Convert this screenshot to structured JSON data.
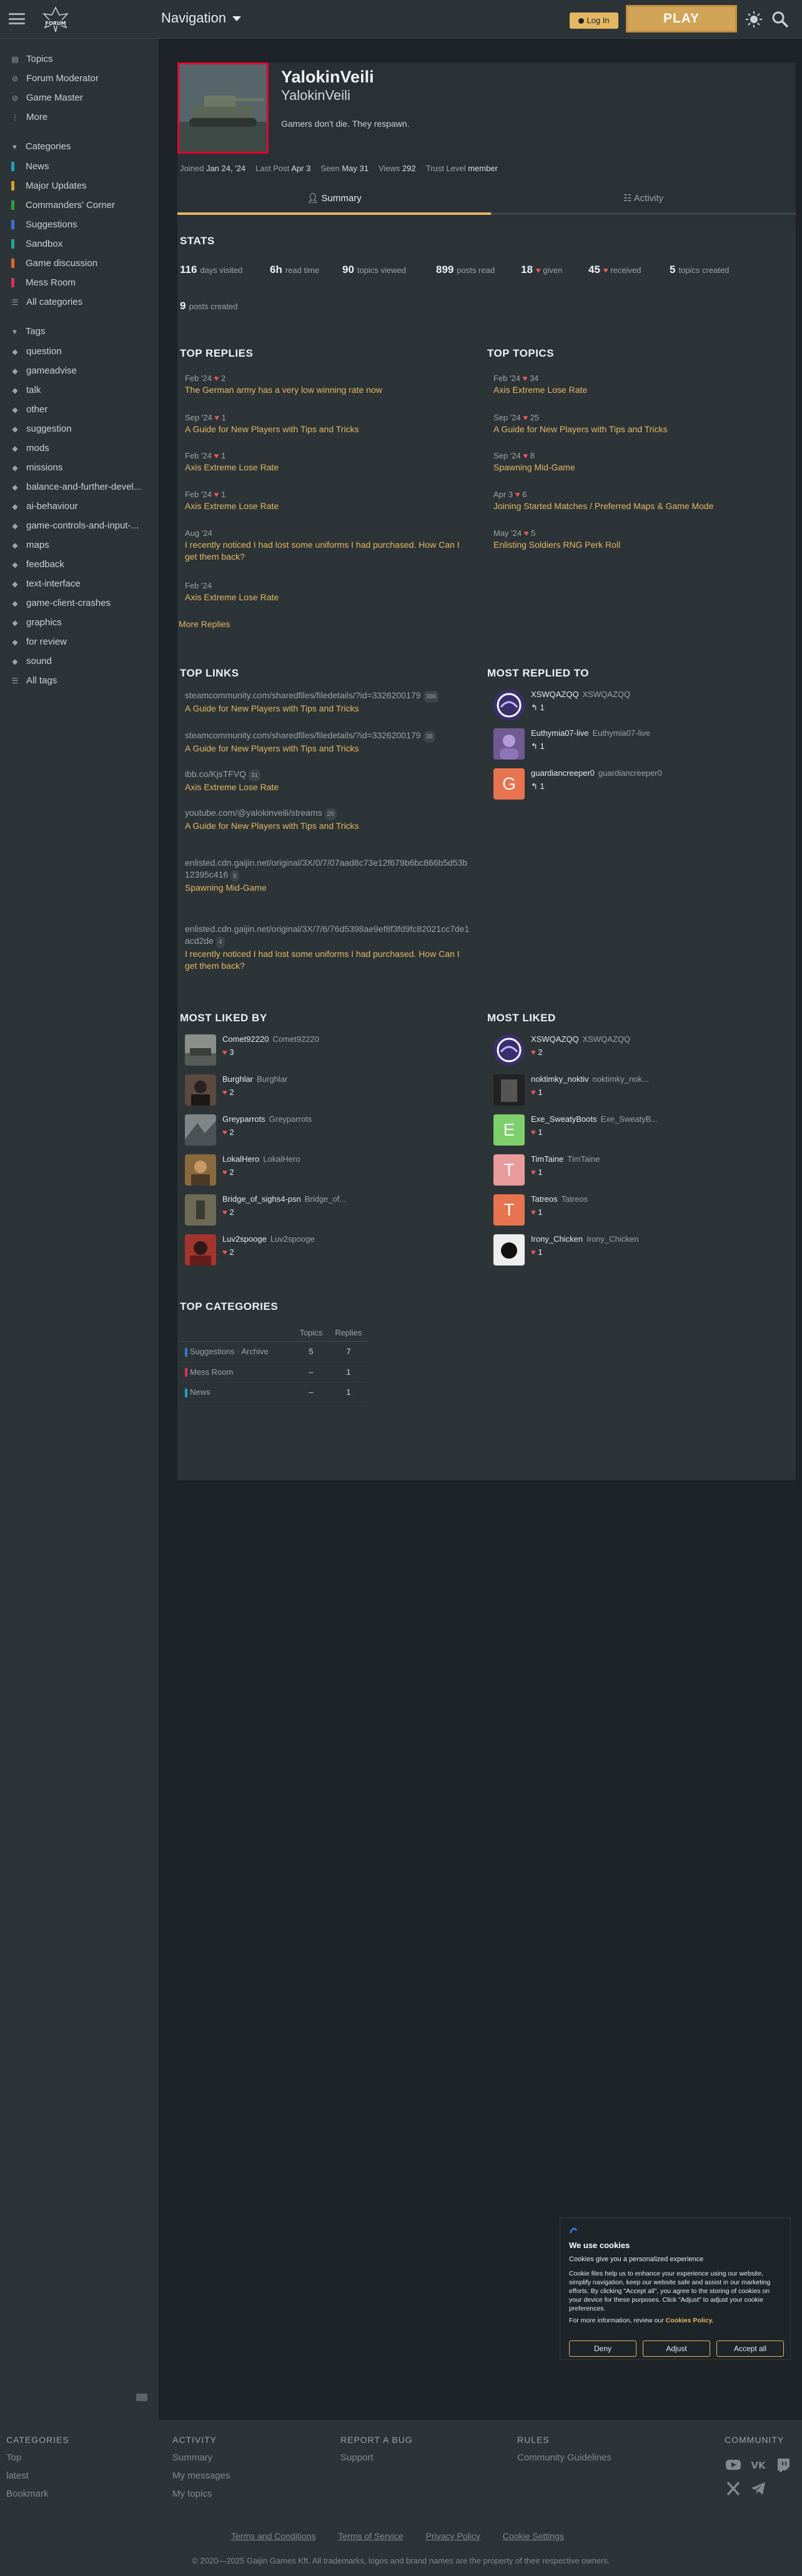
{
  "header": {
    "nav_label": "Navigation",
    "login_label": "Log In",
    "play_label": "PLAY"
  },
  "sidebar": {
    "top_items": [
      {
        "label": "Topics",
        "icon": "topics-icon"
      },
      {
        "label": "Forum Moderator",
        "icon": "link-icon"
      },
      {
        "label": "Game Master",
        "icon": "link-icon"
      },
      {
        "label": "More",
        "icon": "more-icon"
      }
    ],
    "categories_head": "Categories",
    "categories": [
      {
        "label": "News",
        "color": "#1ca3c4"
      },
      {
        "label": "Major Updates",
        "color": "#d9a12a"
      },
      {
        "label": "Commanders' Corner",
        "color": "#2f9e44"
      },
      {
        "label": "Suggestions",
        "color": "#3c6fd8"
      },
      {
        "label": "Sandbox",
        "color": "#27a19b"
      },
      {
        "label": "Game discussion",
        "color": "#e8622c"
      },
      {
        "label": "Mess Room",
        "color": "#d6335b"
      },
      {
        "label": "All categories",
        "color": ""
      }
    ],
    "tags_head": "Tags",
    "tags": [
      "question",
      "gameadvise",
      "talk",
      "other",
      "suggestion",
      "mods",
      "missions",
      "balance-and-further-devel...",
      "ai-behaviour",
      "game-controls-and-input-...",
      "maps",
      "feedback",
      "text-interface",
      "game-client-crashes",
      "graphics",
      "for review",
      "sound",
      "All tags"
    ]
  },
  "profile": {
    "name": "YalokinVeili",
    "username": "YalokinVeili",
    "bio": "Gamers don't die. They respawn.",
    "meta": [
      {
        "label": "Joined",
        "value": "Jan 24, '24"
      },
      {
        "label": "Last Post",
        "value": "Apr 3"
      },
      {
        "label": "Seen",
        "value": "May 31"
      },
      {
        "label": "Views",
        "value": "292"
      },
      {
        "label": "Trust Level",
        "value": "member"
      }
    ],
    "tab_summary": "Summary",
    "tab_activity": "Activity"
  },
  "stats": {
    "title": "STATS",
    "items": [
      {
        "n": "116",
        "label": "days visited"
      },
      {
        "n": "6h",
        "label": "read time"
      },
      {
        "n": "90",
        "label": "topics viewed"
      },
      {
        "n": "899",
        "label": "posts read"
      },
      {
        "n": "18",
        "label": "given",
        "heart": true
      },
      {
        "n": "45",
        "label": "received",
        "heart": true
      },
      {
        "n": "5",
        "label": "topics created"
      },
      {
        "n": "9",
        "label": "posts created"
      }
    ]
  },
  "top_replies": {
    "title": "TOP REPLIES",
    "items": [
      {
        "date": "Feb '24",
        "likes": "2",
        "title": "The German army has a very low winning rate now"
      },
      {
        "date": "Sep '24",
        "likes": "1",
        "title": "A Guide for New Players with Tips and Tricks"
      },
      {
        "date": "Feb '24",
        "likes": "1",
        "title": "Axis Extreme Lose Rate"
      },
      {
        "date": "Feb '24",
        "likes": "1",
        "title": "Axis Extreme Lose Rate"
      },
      {
        "date": "Aug '24",
        "likes": "",
        "title": "I recently noticed I had lost some uniforms I had purchased. How Can I get them back?"
      },
      {
        "date": "Feb '24",
        "likes": "",
        "title": "Axis Extreme Lose Rate"
      }
    ],
    "more": "More Replies"
  },
  "top_topics": {
    "title": "TOP TOPICS",
    "items": [
      {
        "date": "Feb '24",
        "likes": "34",
        "title": "Axis Extreme Lose Rate"
      },
      {
        "date": "Sep '24",
        "likes": "25",
        "title": "A Guide for New Players with Tips and Tricks"
      },
      {
        "date": "Sep '24",
        "likes": "8",
        "title": "Spawning Mid-Game"
      },
      {
        "date": "Apr 3",
        "likes": "6",
        "title": "Joining Started Matches / Preferred Maps & Game Mode"
      },
      {
        "date": "May '24",
        "likes": "5",
        "title": "Enlisting Soldiers RNG Perk Roll"
      }
    ]
  },
  "top_links": {
    "title": "TOP LINKS",
    "items": [
      {
        "url": "steamcommunity.com/sharedfiles/filedetails/?id=3326200179",
        "count": "386",
        "title": "A Guide for New Players with Tips and Tricks"
      },
      {
        "url": "steamcommunity.com/sharedfiles/filedetails/?id=3326200179",
        "count": "38",
        "title": "A Guide for New Players with Tips and Tricks"
      },
      {
        "url": "ibb.co/KjsTFVQ",
        "count": "31",
        "title": "Axis Extreme Lose Rate"
      },
      {
        "url": "youtube.com/@yalokinveili/streams",
        "count": "20",
        "title": "A Guide for New Players with Tips and Tricks"
      },
      {
        "url": "enlisted.cdn.gaijin.net/original/3X/0/7/07aad8c73e12f679b6bc866b5d53b12395c416",
        "count": "6",
        "title": "Spawning Mid-Game"
      },
      {
        "url": "enlisted.cdn.gaijin.net/original/3X/7/6/76d5398ae9ef8f3fd9fc82021cc7de1acd2de",
        "count": "4",
        "title": "I recently noticed I had lost some uniforms I had purchased. How Can I get them back?"
      }
    ]
  },
  "most_replied": {
    "title": "MOST REPLIED TO",
    "items": [
      {
        "name": "XSWQAZQQ",
        "user": "XSWQAZQQ",
        "count": "1",
        "letter": "",
        "color": "#3a2f6e"
      },
      {
        "name": "Euthymia07-live",
        "user": "Euthymia07-live",
        "count": "1",
        "letter": "",
        "color": "#6f5a93"
      },
      {
        "name": "guardiancreeper0",
        "user": "guardiancreeper0",
        "count": "1",
        "letter": "G",
        "color": "#e8744f"
      }
    ]
  },
  "most_liked_by": {
    "title": "MOST LIKED BY",
    "items": [
      {
        "name": "Comet92220",
        "user": "Comet92220",
        "count": "3",
        "color": "#8a8f8c"
      },
      {
        "name": "Burghlar",
        "user": "Burghlar",
        "count": "2",
        "color": "#5d4a3f"
      },
      {
        "name": "Greyparrots",
        "user": "Greyparrots",
        "count": "2",
        "color": "#7f8688"
      },
      {
        "name": "LokalHero",
        "user": "LokalHero",
        "count": "2",
        "color": "#8a6a3c"
      },
      {
        "name": "Bridge_of_sighs4-psn",
        "user": "Bridge_of...",
        "count": "2",
        "color": "#6d6b56"
      },
      {
        "name": "Luv2spooge",
        "user": "Luv2spooge",
        "count": "2",
        "color": "#a3342e"
      }
    ]
  },
  "most_liked": {
    "title": "MOST LIKED",
    "items": [
      {
        "name": "XSWQAZQQ",
        "user": "XSWQAZQQ",
        "count": "2",
        "letter": "",
        "color": "#3a2f6e"
      },
      {
        "name": "noktimky_noktiv",
        "user": "noktimky_nok...",
        "count": "1",
        "letter": "",
        "color": "#222"
      },
      {
        "name": "Exe_SweatyBoots",
        "user": "Exe_SweatyB...",
        "count": "1",
        "letter": "E",
        "color": "#7ccf6a"
      },
      {
        "name": "TimTaine",
        "user": "TimTaine",
        "count": "1",
        "letter": "T",
        "color": "#e99a9a"
      },
      {
        "name": "Tatreos",
        "user": "Tatreos",
        "count": "1",
        "letter": "T",
        "color": "#e8744f"
      },
      {
        "name": "Irony_Chicken",
        "user": "Irony_Chicken",
        "count": "1",
        "letter": "",
        "color": "#444"
      }
    ]
  },
  "top_categories": {
    "title": "TOP CATEGORIES",
    "col_topics": "Topics",
    "col_replies": "Replies",
    "rows": [
      {
        "name": "Suggestions · Archive",
        "topics": "5",
        "replies": "7",
        "color": "#3c6fd8"
      },
      {
        "name": "Mess Room",
        "topics": "–",
        "replies": "1",
        "color": "#d6335b"
      },
      {
        "name": "News",
        "topics": "–",
        "replies": "1",
        "color": "#1ca3c4"
      }
    ]
  },
  "cookie": {
    "title": "We use cookies",
    "p1": "Cookies give you a personalized experience",
    "p2": "Cookie files help us to enhance your experience using our website, simplify navigation, keep our website safe and assist in our marketing efforts. By clicking \"Accept all\", you agree to the storing of cookies on your device for these purposes. Click \"Adjust\" to adjust your cookie preferences.",
    "p3": "For more information, review our",
    "policy": "Cookies Policy.",
    "deny": "Deny",
    "adjust": "Adjust",
    "accept": "Accept all"
  },
  "footer": {
    "categories_head": "CATEGORIES",
    "categories": [
      "Top",
      "latest",
      "Bookmark"
    ],
    "activity_head": "ACTIVITY",
    "activity": [
      "Summary",
      "My messages",
      "My topics"
    ],
    "bug_head": "REPORT A BUG",
    "bug": [
      "Support"
    ],
    "rules_head": "RULES",
    "rules": [
      "Community Guidelines"
    ],
    "community_head": "COMMUNITY",
    "links": [
      "Terms and Conditions",
      "Terms of Service",
      "Privacy Policy",
      "Cookie Settings"
    ],
    "copyright": "© 2020—2025 Gaijin Games Kft. All trademarks, logos and brand names are the property of their respective owners."
  }
}
